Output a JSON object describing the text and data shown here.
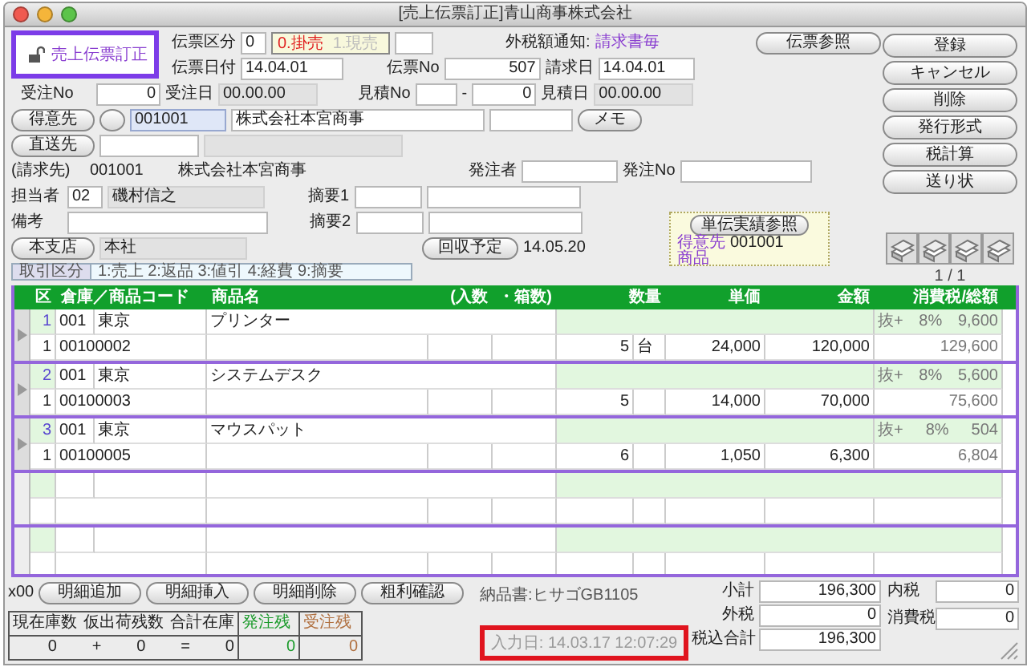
{
  "window": {
    "title": "[売上伝票訂正]青山商事株式会社"
  },
  "mode": {
    "label": "売上伝票訂正",
    "framed": true
  },
  "slip_type": {
    "label": "伝票区分",
    "value": "0",
    "options": [
      {
        "text": "0.掛売",
        "selected": true
      },
      {
        "text": "1.現売",
        "selected": false
      }
    ]
  },
  "tax_notice": {
    "label": "外税額通知:",
    "value": "請求書毎"
  },
  "slip_ref_button": "伝票参照",
  "slip_date": {
    "label": "伝票日付",
    "value": "14.04.01"
  },
  "slip_no": {
    "label": "伝票No",
    "value": "507"
  },
  "billing_date": {
    "label": "請求日",
    "value": "14.04.01"
  },
  "order_no": {
    "label": "受注No",
    "value": "0"
  },
  "order_date": {
    "label": "受注日",
    "value": "00.00.00"
  },
  "estimate_no": {
    "label": "見積No",
    "separator": "-",
    "value": "0"
  },
  "estimate_date": {
    "label": "見積日",
    "value": "00.00.00"
  },
  "customer": {
    "button": "得意先",
    "code": "001001",
    "name": "株式会社本宮商事",
    "memo_button": "メモ"
  },
  "ship_to": {
    "button": "直送先"
  },
  "bill_to": {
    "label": "(請求先)",
    "code": "001001",
    "name": "株式会社本宮商事"
  },
  "orderer": {
    "label": "発注者"
  },
  "order_ref": {
    "label": "発注No"
  },
  "staff": {
    "label": "担当者",
    "code": "02",
    "name": "磯村信之"
  },
  "summary1": {
    "label": "摘要1"
  },
  "summary2": {
    "label": "摘要2"
  },
  "remarks": {
    "label": "備考"
  },
  "branch": {
    "button": "本支店",
    "value": "本社"
  },
  "collection": {
    "button": "回収予定",
    "date": "14.05.20"
  },
  "history": {
    "button": "単伝実績参照",
    "customer_label": "得意先",
    "customer_code": "001001",
    "product_label": "商品"
  },
  "actions": [
    "登録",
    "キャンセル",
    "削除",
    "発行形式",
    "税計算",
    "送り状"
  ],
  "page": {
    "text": "1 / 1"
  },
  "legend": {
    "label": "取引区分",
    "text": "1:売上 2:返品 3:値引 4:経費 9:摘要"
  },
  "table": {
    "columns": [
      "区",
      "倉庫／商品コード",
      "商品名",
      "(入数",
      "・箱数)",
      "数量",
      "単価",
      "金額",
      "消費税/総額"
    ],
    "rows": [
      {
        "no": "1",
        "warehouse": "001",
        "warehouse_name": "東京",
        "product": "プリンター",
        "tax": "抜+",
        "rate": "8%",
        "tax_amount": "9,600",
        "type": "1",
        "code": "00100002",
        "qty": "5",
        "unit": "台",
        "price": "24,000",
        "amount": "120,000",
        "total": "129,600"
      },
      {
        "no": "2",
        "warehouse": "001",
        "warehouse_name": "東京",
        "product": "システムデスク",
        "tax": "抜+",
        "rate": "8%",
        "tax_amount": "5,600",
        "type": "1",
        "code": "00100003",
        "qty": "5",
        "price": "14,000",
        "amount": "70,000",
        "total": "75,600"
      },
      {
        "no": "3",
        "warehouse": "001",
        "warehouse_name": "東京",
        "product": "マウスパット",
        "tax": "抜+",
        "rate": "8%",
        "tax_amount": "504",
        "type": "1",
        "code": "00100005",
        "qty": "6",
        "price": "1,050",
        "amount": "6,300",
        "total": "6,804"
      }
    ]
  },
  "footer": {
    "prefix": "x00",
    "buttons": [
      "明細追加",
      "明細挿入",
      "明細削除",
      "粗利確認"
    ],
    "delivery_note": "納品書:ヒサゴGB1105",
    "entry_time": {
      "text": "入力日: 14.03.17 12:07:29",
      "highlighted": true
    }
  },
  "stock": {
    "columns": [
      "現在庫数",
      "仮出荷残数",
      "合計在庫",
      "発注残",
      "受注残"
    ],
    "values": [
      "0",
      "0",
      "0",
      "0",
      "0"
    ],
    "operators": [
      "+",
      "="
    ]
  },
  "totals": [
    {
      "label": "小計",
      "value": "196,300"
    },
    {
      "label": "外税",
      "value": "0"
    },
    {
      "label": "税込合計",
      "value": "196,300"
    }
  ],
  "taxes": [
    {
      "label": "内税",
      "value": "0"
    },
    {
      "label": "消費税",
      "value": "0"
    }
  ]
}
